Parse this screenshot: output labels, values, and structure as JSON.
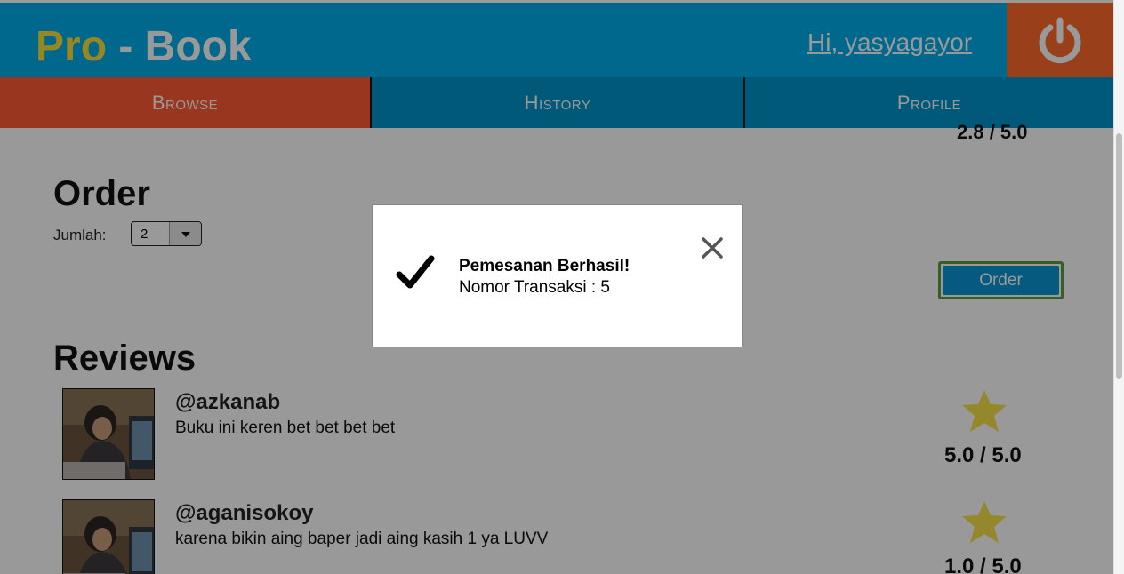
{
  "header": {
    "logo_pro": "Pro",
    "logo_rest": " - Book",
    "greeting": "Hi, yasyagayor",
    "logout_icon": "power-icon",
    "colors": {
      "header_bg": "#00aeea",
      "logout_bg": "#ff6a2b",
      "logo_accent": "#f8e13a"
    }
  },
  "nav": {
    "items": [
      {
        "label": "Browse",
        "active": true
      },
      {
        "label": "History",
        "active": false
      },
      {
        "label": "Profile",
        "active": false
      }
    ],
    "colors": {
      "active": "#ff5a36",
      "inactive": "#0095c8"
    }
  },
  "book": {
    "rating": "2.8 / 5.0"
  },
  "order": {
    "title": "Order",
    "quantity_label": "Jumlah:",
    "quantity_value": "2",
    "button_label": "Order"
  },
  "reviews": {
    "title": "Reviews",
    "items": [
      {
        "username": "@azkanab",
        "text": "Buku ini keren bet bet bet bet",
        "score": "5.0 / 5.0",
        "icon": "star-icon"
      },
      {
        "username": "@aganisokoy",
        "text": "karena bikin aing baper jadi aing kasih 1 ya LUVV",
        "score": "1.0 / 5.0",
        "icon": "star-icon"
      }
    ]
  },
  "modal": {
    "title": "Pemesanan Berhasil!",
    "message": "Nomor Transaksi : 5",
    "check_icon": "check-icon",
    "close_icon": "close-icon"
  }
}
